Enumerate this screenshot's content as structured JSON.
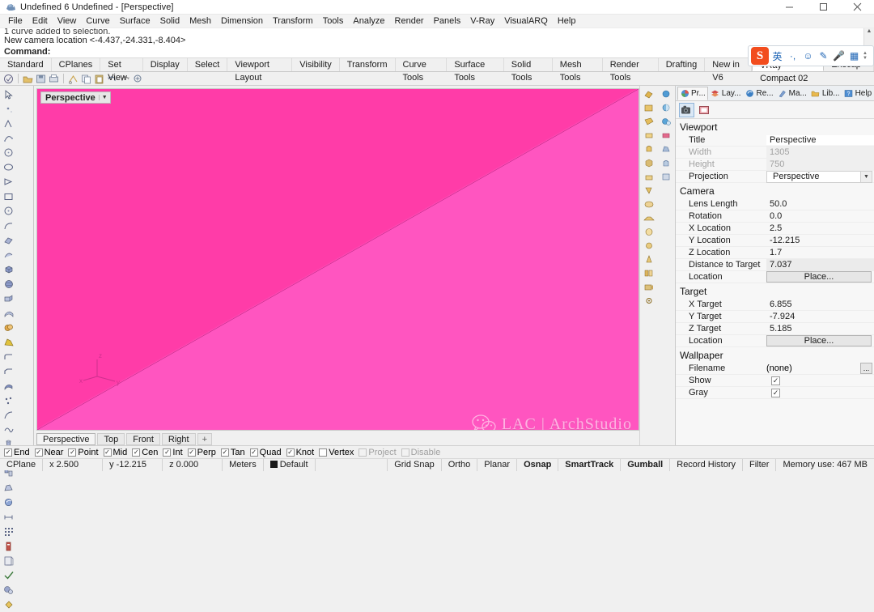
{
  "window": {
    "title": "Undefined 6 Undefined - [Perspective]",
    "app_icon": "rhino-icon",
    "minimize": "minimize-icon",
    "maximize": "maximize-icon",
    "close": "close-icon"
  },
  "menubar": {
    "items": [
      "File",
      "Edit",
      "View",
      "Curve",
      "Surface",
      "Solid",
      "Mesh",
      "Dimension",
      "Transform",
      "Tools",
      "Analyze",
      "Render",
      "Panels",
      "V-Ray",
      "VisualARQ",
      "Help"
    ]
  },
  "command_history": {
    "clipped_line": "1 curve added to selection.",
    "line_2": "New camera location <-4.437,-24.331,-8.404>",
    "prompt": "Command:"
  },
  "toolbar_tabs": {
    "items": [
      "Standard",
      "CPlanes",
      "Set View",
      "Display",
      "Select",
      "Viewport Layout",
      "Visibility",
      "Transform",
      "Curve Tools",
      "Surface Tools",
      "Solid Tools",
      "Mesh Tools",
      "Render Tools",
      "Drafting",
      "New in V6",
      "VRay Compact 02",
      "Enscap»"
    ],
    "selected": "VRay Compact 02"
  },
  "ime": {
    "logo": "sogou-logo",
    "icons": [
      "chinese-mode-icon",
      "punctuation-icon",
      "emoji-icon",
      "handwriting-icon",
      "voice-input-icon",
      "toolbox-icon"
    ]
  },
  "standard_icons": [
    "new-file-icon",
    "open-file-icon",
    "save-icon",
    "print-icon",
    "cut-icon",
    "copy-icon",
    "paste-icon",
    "undo-icon",
    "redo-icon",
    "zoom-extents-icon"
  ],
  "viewport": {
    "label": "Perspective",
    "dropdown_icon": "chevron-down-icon",
    "axis_labels": {
      "x": "x",
      "y": "y",
      "z": "z"
    },
    "watermark": "LAC | ArchStudio",
    "watermark_icon": "wechat-icon",
    "background_upper": "#ff3ca8",
    "background_lower": "#ff55c0",
    "edge_color": "#8c1060",
    "tabs": [
      "Perspective",
      "Top",
      "Front",
      "Right"
    ],
    "selected_tab": "Perspective",
    "add_tab_icon": "plus-icon"
  },
  "panel": {
    "tabs": [
      {
        "label": "Pr...",
        "icon": "properties-icon",
        "selected": true
      },
      {
        "label": "Lay...",
        "icon": "layers-icon",
        "selected": false
      },
      {
        "label": "Re...",
        "icon": "render-icon",
        "selected": false
      },
      {
        "label": "Ma...",
        "icon": "materials-icon",
        "selected": false
      },
      {
        "label": "Lib...",
        "icon": "libraries-folder-icon",
        "selected": false
      },
      {
        "label": "Help",
        "icon": "help-icon",
        "selected": false
      }
    ],
    "settings_icon": "gear-icon",
    "tool_buttons": [
      {
        "icon": "camera-icon",
        "active": true
      },
      {
        "icon": "display-mode-icon",
        "active": false
      }
    ],
    "sections": [
      {
        "title": "Viewport",
        "rows": [
          {
            "key": "Title",
            "value": "Perspective",
            "type": "text-selected",
            "dim": false
          },
          {
            "key": "Width",
            "value": "1305",
            "type": "readonly",
            "dim": true
          },
          {
            "key": "Height",
            "value": "750",
            "type": "readonly",
            "dim": true
          },
          {
            "key": "Projection",
            "value": "Perspective",
            "type": "combo",
            "dim": false
          }
        ]
      },
      {
        "title": "Camera",
        "rows": [
          {
            "key": "Lens Length",
            "value": "50.0",
            "type": "text",
            "dim": false
          },
          {
            "key": "Rotation",
            "value": "0.0",
            "type": "text",
            "dim": false
          },
          {
            "key": "X Location",
            "value": "2.5",
            "type": "text",
            "dim": false
          },
          {
            "key": "Y Location",
            "value": "-12.215",
            "type": "text",
            "dim": false
          },
          {
            "key": "Z Location",
            "value": "1.7",
            "type": "text",
            "dim": false
          },
          {
            "key": "Distance to Target",
            "value": "7.037",
            "type": "readonly",
            "dim": false
          },
          {
            "key": "Location",
            "value": "Place...",
            "type": "button",
            "dim": false
          }
        ]
      },
      {
        "title": "Target",
        "rows": [
          {
            "key": "X Target",
            "value": "6.855",
            "type": "text",
            "dim": false
          },
          {
            "key": "Y Target",
            "value": "-7.924",
            "type": "text",
            "dim": false
          },
          {
            "key": "Z Target",
            "value": "5.185",
            "type": "text",
            "dim": false
          },
          {
            "key": "Location",
            "value": "Place...",
            "type": "button",
            "dim": false
          }
        ]
      },
      {
        "title": "Wallpaper",
        "rows": [
          {
            "key": "Filename",
            "value": "(none)",
            "type": "file",
            "dim": false
          },
          {
            "key": "Show",
            "value": "✓",
            "type": "checkbox",
            "dim": false
          },
          {
            "key": "Gray",
            "value": "✓",
            "type": "checkbox",
            "dim": false
          }
        ]
      }
    ],
    "file_browse_label": "..."
  },
  "osnap": {
    "items": [
      {
        "label": "End",
        "checked": true,
        "enabled": true
      },
      {
        "label": "Near",
        "checked": true,
        "enabled": true
      },
      {
        "label": "Point",
        "checked": true,
        "enabled": true
      },
      {
        "label": "Mid",
        "checked": true,
        "enabled": true
      },
      {
        "label": "Cen",
        "checked": true,
        "enabled": true
      },
      {
        "label": "Int",
        "checked": true,
        "enabled": true
      },
      {
        "label": "Perp",
        "checked": true,
        "enabled": true
      },
      {
        "label": "Tan",
        "checked": true,
        "enabled": true
      },
      {
        "label": "Quad",
        "checked": true,
        "enabled": true
      },
      {
        "label": "Knot",
        "checked": true,
        "enabled": true
      },
      {
        "label": "Vertex",
        "checked": false,
        "enabled": true
      },
      {
        "label": "Project",
        "checked": false,
        "enabled": false
      },
      {
        "label": "Disable",
        "checked": false,
        "enabled": false
      }
    ]
  },
  "statusbar": {
    "cplane": "CPlane",
    "x": "x 2.500",
    "y": "y -12.215",
    "z": "z 0.000",
    "units": "Meters",
    "layer": "Default",
    "layer_color": "#1a1a1a",
    "grid_snap": "Grid Snap",
    "ortho": "Ortho",
    "planar": "Planar",
    "osnap": "Osnap",
    "smarttrack": "SmartTrack",
    "gumball": "Gumball",
    "record_history": "Record History",
    "filter": "Filter",
    "memory": "Memory use: 467 MB"
  }
}
